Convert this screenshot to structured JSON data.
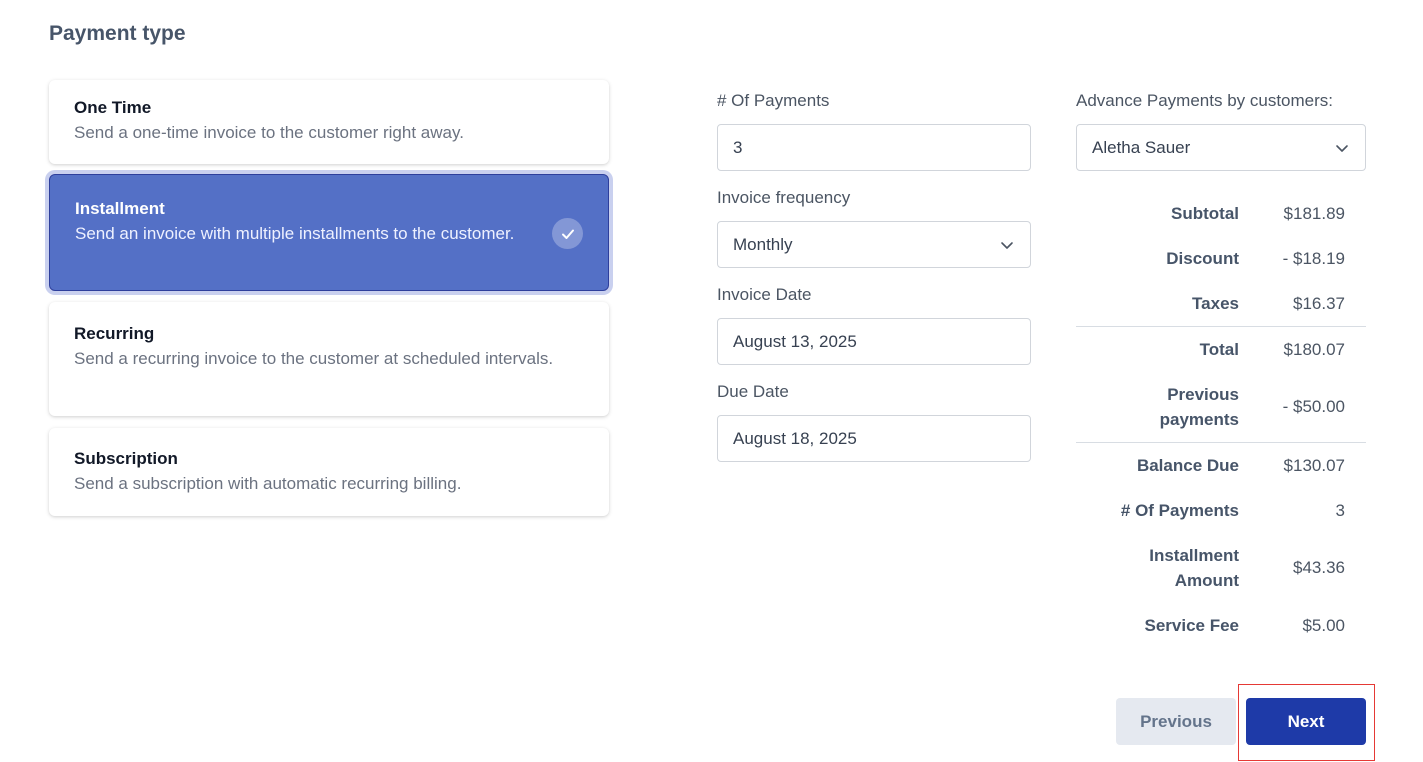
{
  "section_title": "Payment type",
  "payment_types": [
    {
      "title": "One Time",
      "description": "Send a one-time invoice to the customer right away."
    },
    {
      "title": "Installment",
      "description": "Send an invoice with multiple installments to the customer."
    },
    {
      "title": "Recurring",
      "description": "Send a recurring invoice to the customer at scheduled intervals."
    },
    {
      "title": "Subscription",
      "description": "Send a subscription with automatic recurring billing."
    }
  ],
  "selected_type": "Installment",
  "form": {
    "num_payments_label": "# Of Payments",
    "num_payments_value": "3",
    "frequency_label": "Invoice frequency",
    "frequency_value": "Monthly",
    "invoice_date_label": "Invoice Date",
    "invoice_date_value": "August 13, 2025",
    "due_date_label": "Due Date",
    "due_date_value": "August 18, 2025"
  },
  "advance": {
    "label": "Advance Payments by customers:",
    "selected": "Aletha Sauer"
  },
  "summary": {
    "subtotal_label": "Subtotal",
    "subtotal": "$181.89",
    "discount_label": "Discount",
    "discount": "- $18.19",
    "taxes_label": "Taxes",
    "taxes": "$16.37",
    "total_label": "Total",
    "total": "$180.07",
    "previous_label_1": "Previous",
    "previous_label_2": "payments",
    "previous": "- $50.00",
    "balance_label": "Balance Due",
    "balance": "$130.07",
    "num_payments_label": "# Of Payments",
    "num_payments": "3",
    "installment_label_1": "Installment",
    "installment_label_2": "Amount",
    "installment": "$43.36",
    "service_fee_label": "Service Fee",
    "service_fee": "$5.00"
  },
  "buttons": {
    "previous": "Previous",
    "next": "Next"
  },
  "icons": {
    "check": "check-icon",
    "chevron": "chevron-down-icon"
  },
  "colors": {
    "selected_card": "#5470c6",
    "primary_button": "#1e3aa8",
    "highlight": "#e53935"
  }
}
